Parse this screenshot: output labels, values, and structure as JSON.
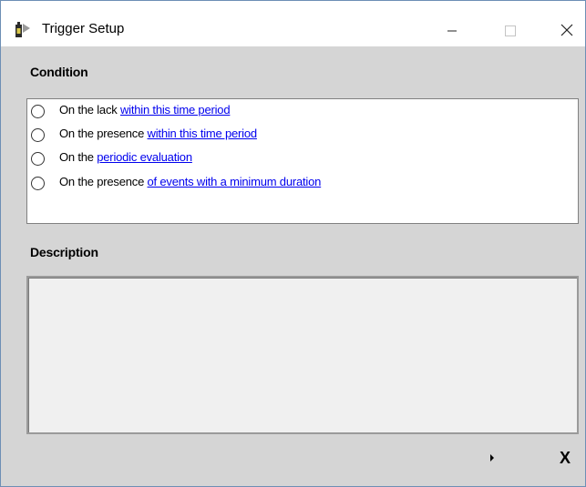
{
  "window": {
    "title": "Trigger Setup",
    "icon": "trigger-app-icon"
  },
  "titlebar_buttons": {
    "minimize": "minimize-icon",
    "maximize": "maximize-icon",
    "close": "close-icon"
  },
  "condition": {
    "label": "Condition",
    "options": [
      {
        "prefix": "On the lack ",
        "link": "within this time period",
        "selected": false
      },
      {
        "prefix": "On the presence ",
        "link": "within this time period",
        "selected": false
      },
      {
        "prefix": "On the ",
        "link": "periodic evaluation",
        "selected": false
      },
      {
        "prefix": "On the presence ",
        "link": "of events with a minimum duration",
        "selected": false
      }
    ]
  },
  "description": {
    "label": "Description",
    "value": ""
  },
  "footer": {
    "next_icon": "play-arrow-icon",
    "cancel_label": "X"
  },
  "colors": {
    "link": "#0000ee",
    "client_background": "#d5d5d5",
    "window_border": "#6d8fb5"
  }
}
